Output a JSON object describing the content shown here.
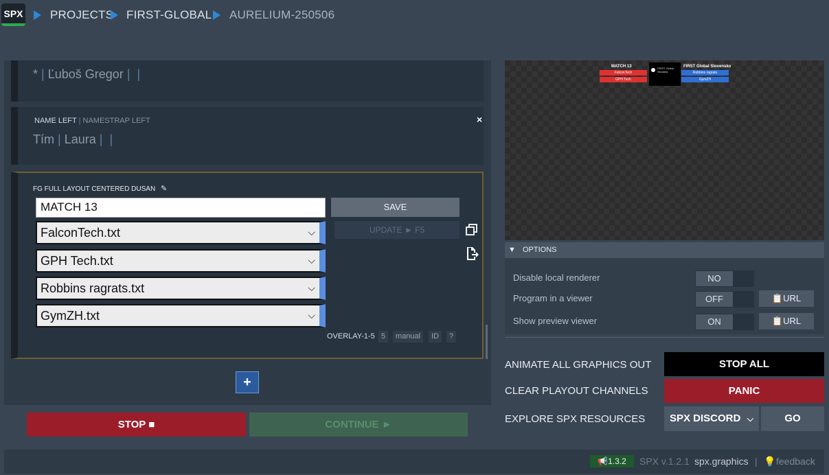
{
  "header": {
    "logo": "SPX",
    "breadcrumb": [
      "PROJECTS",
      "FIRST-GLOBAL",
      "AURELIUM-250506"
    ]
  },
  "cards": {
    "card1": {
      "prefix": "*",
      "value": "Ľuboš Gregor"
    },
    "card2": {
      "label": "NAME LEFT",
      "sublabel": "NAMESTRAP LEFT",
      "value1": "Tím",
      "value2": "Laura",
      "close": "×"
    },
    "card3": {
      "title": "FG FULL LAYOUT CENTERED DUSAN",
      "input_value": "MATCH 13",
      "selects": [
        "FalconTech.txt",
        "GPH Tech.txt",
        "Robbins ragrats.txt",
        "GymZH.txt"
      ],
      "save_label": "SAVE",
      "update_label": "UPDATE ► F5",
      "tags": {
        "layer": "OVERLAY-1-5",
        "channel": "5",
        "mode": "manual",
        "id": "ID",
        "help": "?"
      }
    }
  },
  "add_label": "+",
  "stop_label": "STOP ■",
  "continue_label": "CONTINUE ►",
  "preview": {
    "left_title": "MATCH 13",
    "left_bars": [
      "FalconTech",
      "GPH Tech"
    ],
    "logo_text": "FIRST Global Slovakia",
    "right_title": "FIRST Global Slovensko",
    "right_bars": [
      "Robbins ragrats",
      "GymZH"
    ],
    "colors": {
      "red": "#e03131",
      "blue": "#2f6fd6"
    }
  },
  "options": {
    "header": "OPTIONS",
    "rows": [
      {
        "label": "Disable local renderer",
        "state": "NO"
      },
      {
        "label": "Program in a viewer",
        "state": "OFF",
        "url": "URL"
      },
      {
        "label": "Show preview viewer",
        "state": "ON",
        "url": "URL"
      }
    ]
  },
  "actions": {
    "animate_label": "ANIMATE ALL GRAPHICS OUT",
    "stopall": "STOP ALL",
    "clear_label": "CLEAR PLAYOUT CHANNELS",
    "panic": "PANIC",
    "explore_label": "EXPLORE SPX RESOURCES",
    "discord": "SPX DISCORD",
    "go": "GO"
  },
  "footer": {
    "badge": "1.3.2",
    "version": "SPX v.1.2.1",
    "site": "spx.graphics",
    "sep": "|",
    "feedback": "feedback"
  }
}
